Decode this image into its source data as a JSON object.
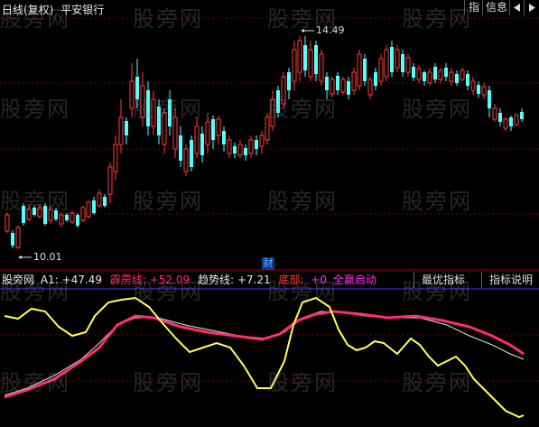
{
  "title_bar": {
    "period": "日线(复权)",
    "stock_name": "平安银行",
    "btn_indicator": "指",
    "btn_info": "信息",
    "btn_nav_left_icon": "triangle-left-icon",
    "btn_nav_right_icon": "triangle-right-icon"
  },
  "price_chart": {
    "high_label": "14.49",
    "low_label": "10.01",
    "cai_badge": "财"
  },
  "indicator_bar": {
    "name": "股旁网",
    "a1_label": "A1:",
    "a1_value": "+47.49",
    "pili_label": "霹雳线:",
    "pili_value": "+52.09",
    "trend_label": "趋势线:",
    "trend_value": "+7.21",
    "bottom_label": "底部:",
    "bottom_value": "+0",
    "fullstart_label": "全赢启动",
    "best_indicator_btn": "最优指标",
    "indicator_help_btn": "指标说明"
  },
  "watermark": "股旁网",
  "colors": {
    "up": "#ff3a3a",
    "down": "#54ffff",
    "yellow_line": "#ffff55",
    "pink_line": "#ff2d6e",
    "white_line": "#e0e0e0",
    "grid": "#7a0000",
    "blue_line": "#3a3aff"
  },
  "candles": [
    [
      8.0,
      -6,
      24,
      -6,
      24
    ],
    [
      22.9,
      -4,
      28,
      -8,
      30
    ],
    [
      16.7,
      5,
      12,
      3,
      10
    ],
    [
      18.2,
      -3,
      22,
      -8,
      24
    ],
    [
      23.0,
      -7,
      18,
      -9,
      19
    ],
    [
      27.5,
      -8,
      12,
      -11,
      13
    ],
    [
      26.2,
      1,
      18,
      0,
      16
    ],
    [
      31.6,
      -6,
      11,
      -12,
      12
    ],
    [
      35.8,
      -11,
      9,
      -12,
      10
    ],
    [
      39.8,
      -11,
      8,
      -16,
      6
    ],
    [
      34.7,
      -2,
      10,
      -5,
      12
    ],
    [
      47.3,
      -10,
      7,
      -13,
      9
    ],
    [
      46.5,
      -3,
      10,
      -6,
      9
    ],
    [
      49.4,
      -6,
      8,
      -11,
      9
    ],
    [
      49.9,
      -3,
      10,
      -4,
      12
    ],
    [
      56.5,
      -14,
      11,
      -15,
      12
    ],
    [
      46.1,
      9,
      11,
      7,
      12
    ],
    [
      49.7,
      -8,
      9,
      -13,
      10
    ],
    [
      51.2,
      -5,
      10,
      -6,
      11
    ],
    [
      62.1,
      -16,
      12,
      -18,
      15
    ],
    [
      60.4,
      -5,
      12,
      -7,
      15
    ],
    [
      58.7,
      -5,
      12,
      -8,
      12
    ],
    [
      73.0,
      -20,
      14,
      -24,
      19
    ],
    [
      82.4,
      -19,
      13,
      -21,
      15
    ],
    [
      75.3,
      -4,
      13,
      -8,
      15
    ],
    [
      72.6,
      -6,
      13,
      -8,
      15
    ],
    [
      63.1,
      6,
      13,
      3,
      15
    ],
    [
      59.7,
      2,
      13,
      0,
      15
    ],
    [
      71.8,
      -16,
      14,
      -17,
      16
    ],
    [
      70.8,
      -7,
      16,
      -9,
      17
    ],
    [
      73.6,
      -11,
      15,
      -11,
      18
    ],
    [
      67.1,
      0,
      18,
      1,
      16
    ],
    [
      61.1,
      1,
      17,
      3,
      13
    ],
    [
      68.3,
      -16,
      15,
      -15,
      17
    ],
    [
      67.6,
      -4,
      14,
      -7,
      15
    ],
    [
      73.1,
      -9,
      13,
      -13,
      13
    ],
    [
      73.6,
      -7,
      16,
      -9,
      16
    ],
    [
      83.2,
      -13,
      14,
      -14,
      14
    ]
  ],
  "notes": ""
}
